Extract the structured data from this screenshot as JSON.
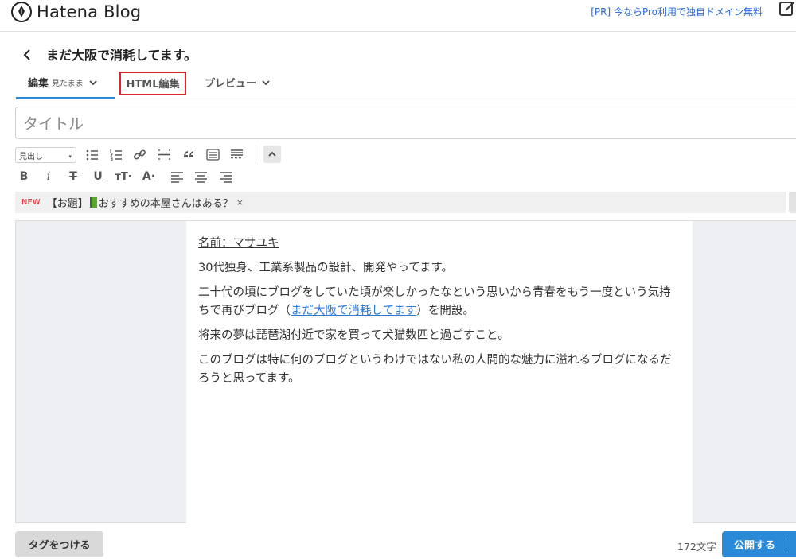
{
  "header": {
    "logo_text": "Hatena Blog",
    "promo_text": "[PR] 今ならPro利用で独自ドメイン無料"
  },
  "blog": {
    "title": "まだ大阪で消耗してます。"
  },
  "tabs": {
    "edit_label": "編集",
    "edit_mode": "見たまま",
    "html_label": "HTML編集",
    "preview_label": "プレビュー"
  },
  "editor": {
    "title_placeholder": "タイトル",
    "heading_select": "見出し",
    "topic_badge": "NEW",
    "topic_prefix": "【お題】",
    "topic_text": "おすすめの本屋さんはある？",
    "topic_close": "×"
  },
  "content": {
    "name_line": "名前：マサユキ",
    "line1": "30代独身、工業系製品の設計、開発やってます。",
    "line2_a": "二十代の頃にブログをしていた頃が楽しかったなという思いから青春をもう一度という気持ちで再びブログ（",
    "line2_link": "まだ大阪で消耗してます",
    "line2_b": "）を開設。",
    "line3": "将来の夢は琵琶湖付近で家を買って犬猫数匹と過ごすこと。",
    "line4": "このブログは特に何のブログというわけではない私の人間的な魅力に溢れるブログになるだろうと思ってます。"
  },
  "footer": {
    "tag_button": "タグをつける",
    "char_count": "172文字",
    "publish_button": "公開する"
  },
  "colors": {
    "accent": "#2a8ad8",
    "highlight_box": "#e0242a",
    "link": "#2a7ad8"
  }
}
